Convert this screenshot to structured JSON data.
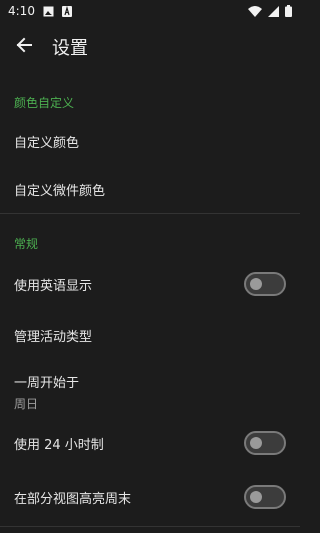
{
  "status_bar": {
    "time": "4:10",
    "icons": [
      "image-icon",
      "a-badge-icon",
      "wifi-icon",
      "signal-icon",
      "battery-icon"
    ]
  },
  "app_bar": {
    "title": "设置",
    "back_icon": "arrow-left-icon"
  },
  "sections": {
    "color_custom": {
      "header": "颜色自定义",
      "items": [
        "自定义颜色",
        "自定义微件颜色"
      ]
    },
    "general": {
      "header": "常规",
      "items": {
        "english": {
          "label": "使用英语显示",
          "toggle": false
        },
        "activity_types": {
          "label": "管理活动类型"
        },
        "week_start": {
          "label": "一周开始于",
          "value": "周日"
        },
        "hour24": {
          "label": "使用 24 小时制",
          "toggle": false
        },
        "highlight_weekends": {
          "label": "在部分视图高亮周末",
          "toggle": false
        }
      }
    }
  },
  "colors": {
    "background": "#1c1c1c",
    "accent": "#4caf50",
    "text_primary": "#e6e6e6",
    "text_secondary": "#9e9e9e"
  }
}
